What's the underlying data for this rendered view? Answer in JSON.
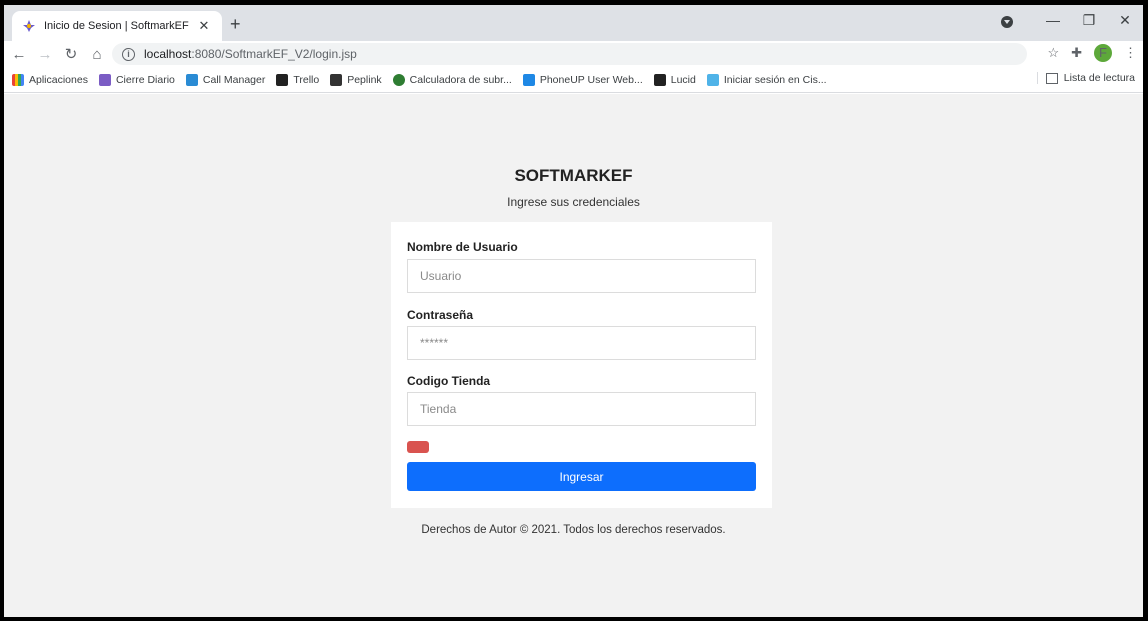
{
  "browser": {
    "tab_title": "Inicio de Sesion | SoftmarkEF",
    "tab_close": "✕",
    "new_tab": "+",
    "url_host": "localhost",
    "url_path": ":8080/SoftmarkEF_V2/login.jsp",
    "profile_initial": "F"
  },
  "bookmarks": [
    {
      "label": "Aplicaciones",
      "color": "#4285f4"
    },
    {
      "label": "Cierre Diario",
      "color": "#7b5cc4"
    },
    {
      "label": "Call Manager",
      "color": "#2a8bd4"
    },
    {
      "label": "Trello",
      "color": "#222222"
    },
    {
      "label": "Peplink",
      "color": "#333333"
    },
    {
      "label": "Calculadora de subr...",
      "color": "#2e7d32"
    },
    {
      "label": "PhoneUP User Web...",
      "color": "#1e88e5"
    },
    {
      "label": "Lucid",
      "color": "#222222"
    },
    {
      "label": "Iniciar sesión en Cis...",
      "color": "#4fb3e8"
    }
  ],
  "reading_list": "Lista de lectura",
  "login": {
    "brand": "SOFTMARKEF",
    "subtitle": "Ingrese sus credenciales",
    "username_label": "Nombre de Usuario",
    "username_placeholder": "Usuario",
    "password_label": "Contraseña",
    "password_placeholder": "******",
    "store_label": "Codigo Tienda",
    "store_placeholder": "Tienda",
    "submit_label": "Ingresar",
    "error_color": "#d9534f",
    "primary_color": "#0d6efd"
  },
  "footer": "Derechos de Autor © 2021. Todos los derechos reservados."
}
